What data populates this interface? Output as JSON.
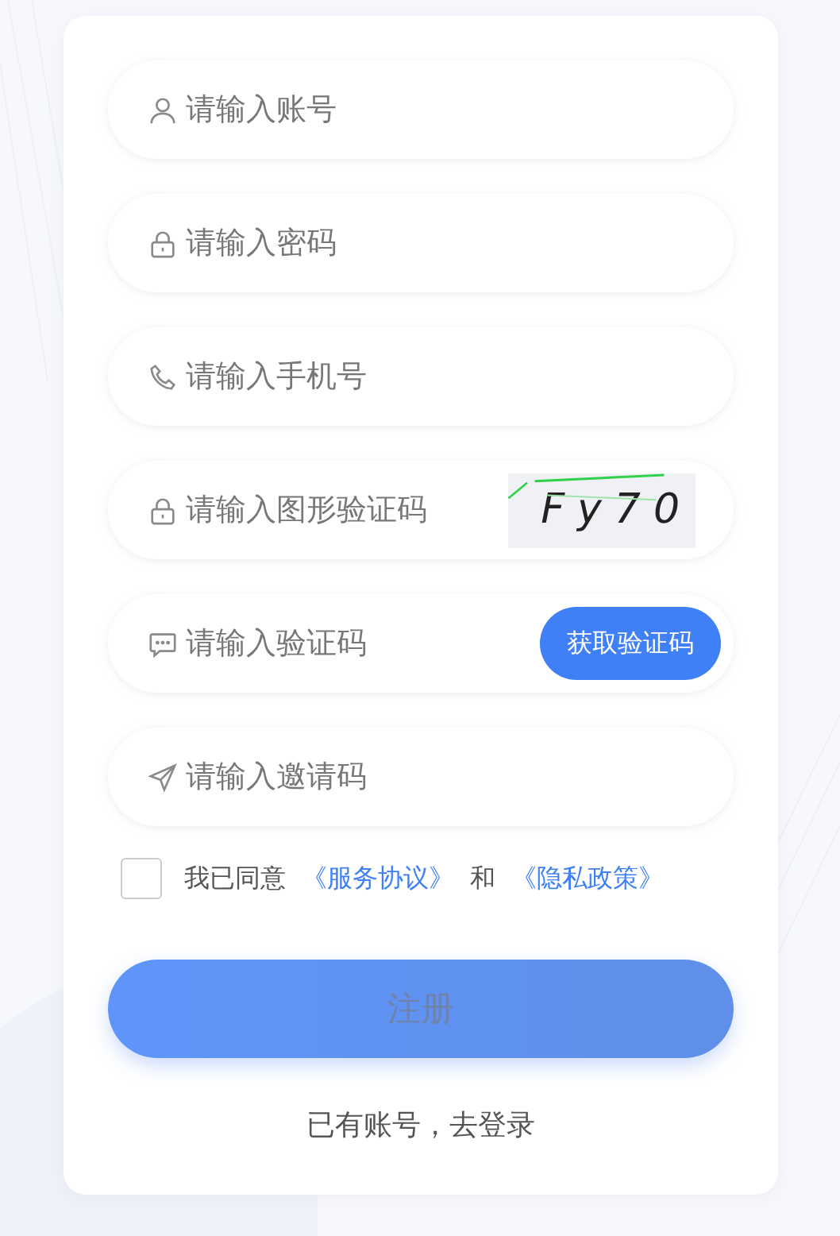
{
  "fields": [
    {
      "kind": "account",
      "placeholder": "请输入账号"
    },
    {
      "kind": "password",
      "placeholder": "请输入密码"
    },
    {
      "kind": "phone",
      "placeholder": "请输入手机号"
    },
    {
      "kind": "captcha",
      "placeholder": "请输入图形验证码",
      "captcha": "Fy70"
    },
    {
      "kind": "sms",
      "placeholder": "请输入验证码",
      "button": "获取验证码"
    },
    {
      "kind": "invite",
      "placeholder": "请输入邀请码"
    }
  ],
  "agreement": {
    "checked": false,
    "text": "我已同意",
    "link_1": "《服务协议》",
    "joiner": "和",
    "link_2": "《隐私政策》"
  },
  "submit": {
    "label": "注册",
    "disabled": true
  },
  "login_link": "已有账号，去登录"
}
